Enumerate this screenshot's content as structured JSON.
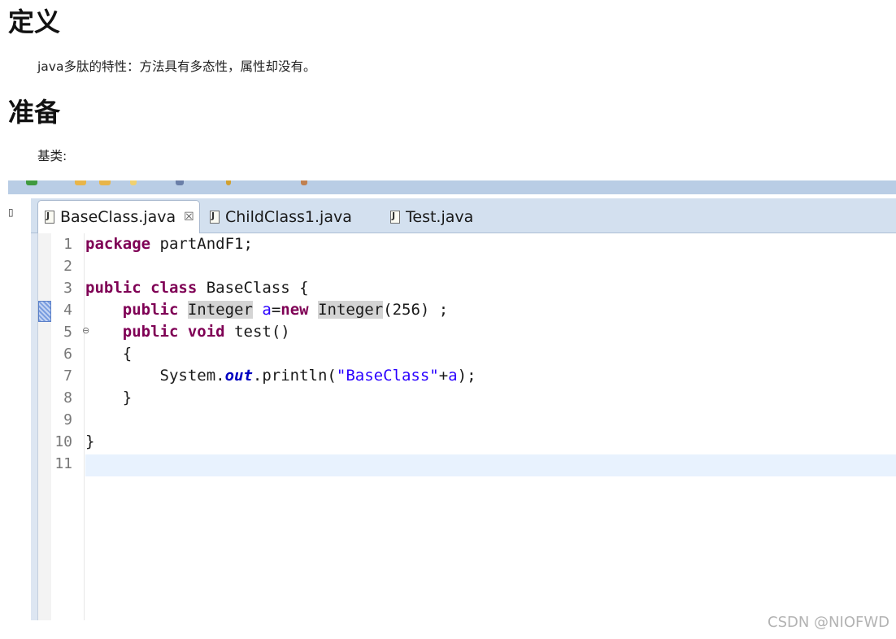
{
  "article": {
    "heading_definition": "定义",
    "para_definition": "java多肽的特性：方法具有多态性，属性却没有。",
    "heading_prep": "准备",
    "para_base": "基类:"
  },
  "ide": {
    "tabs": [
      {
        "label": "BaseClass.java",
        "active": true,
        "close_glyph": "☒"
      },
      {
        "label": "ChildClass1.java",
        "active": false
      },
      {
        "label": "Test.java",
        "active": false
      }
    ],
    "line_numbers": [
      "1",
      "2",
      "3",
      "4",
      "5",
      "6",
      "7",
      "8",
      "9",
      "10",
      "11"
    ],
    "code": {
      "l1_kw": "package",
      "l1_rest": " partAndF1;",
      "l3_kw1": "public",
      "l3_kw2": "class",
      "l3_rest": " BaseClass {",
      "l4_kw1": "public",
      "l4_type": "Integer",
      "l4_var": "a",
      "l4_eq": "=",
      "l4_kw2": "new",
      "l4_type2": "Integer",
      "l4_rest": "(256) ;",
      "l5_kw1": "public",
      "l5_kw2": "void",
      "l5_rest": " test()",
      "l6": "{",
      "l7_a": "System.",
      "l7_field": "out",
      "l7_b": ".println(",
      "l7_str": "\"BaseClass\"",
      "l7_c": "+",
      "l7_var": "a",
      "l7_d": ");",
      "l8": "}",
      "l10": "}"
    },
    "current_line": 11,
    "colors": {
      "keyword": "#7f0055",
      "string": "#2a00ff",
      "field": "#0000c0",
      "toolbar": "#b9cde5",
      "tabstrip": "#d3e0ef"
    }
  },
  "watermark": "CSDN @NIOFWD"
}
